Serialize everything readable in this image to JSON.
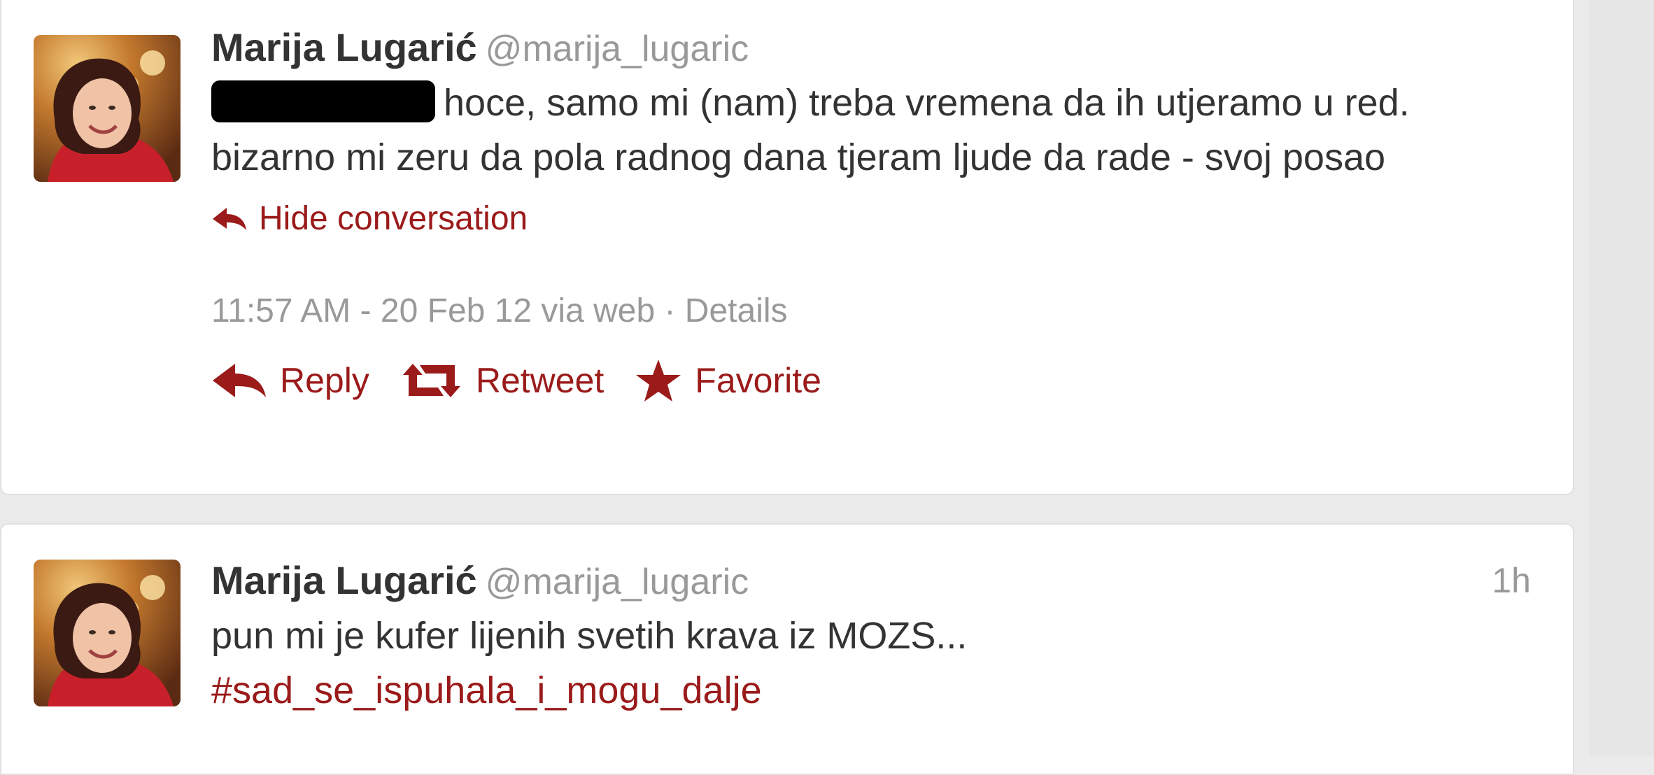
{
  "tweets": [
    {
      "fullname": "Marija Lugarić",
      "username": "@marija_lugaric",
      "time": "",
      "text": "hoce, samo mi (nam) treba vremena da ih utjeramo u red. bizarno mi zeru da pola radnog dana tjeram ljude da rade - svoj posao",
      "hide_conversation": "Hide conversation",
      "meta": "11:57 AM - 20 Feb 12 via web · Details",
      "actions": {
        "reply": "Reply",
        "retweet": "Retweet",
        "favorite": "Favorite"
      }
    },
    {
      "fullname": "Marija Lugarić",
      "username": "@marija_lugaric",
      "time": "1h",
      "text": "pun mi je kufer lijenih svetih krava iz MOZS...",
      "hashtag": "#sad_se_ispuhala_i_mogu_dalje"
    }
  ],
  "colors": {
    "link": "#9b1a1a",
    "muted": "#999999",
    "text": "#333333",
    "background": "#ebebeb"
  },
  "icons": {
    "reply": "reply-arrow-icon",
    "retweet": "retweet-icon",
    "favorite": "star-icon"
  }
}
